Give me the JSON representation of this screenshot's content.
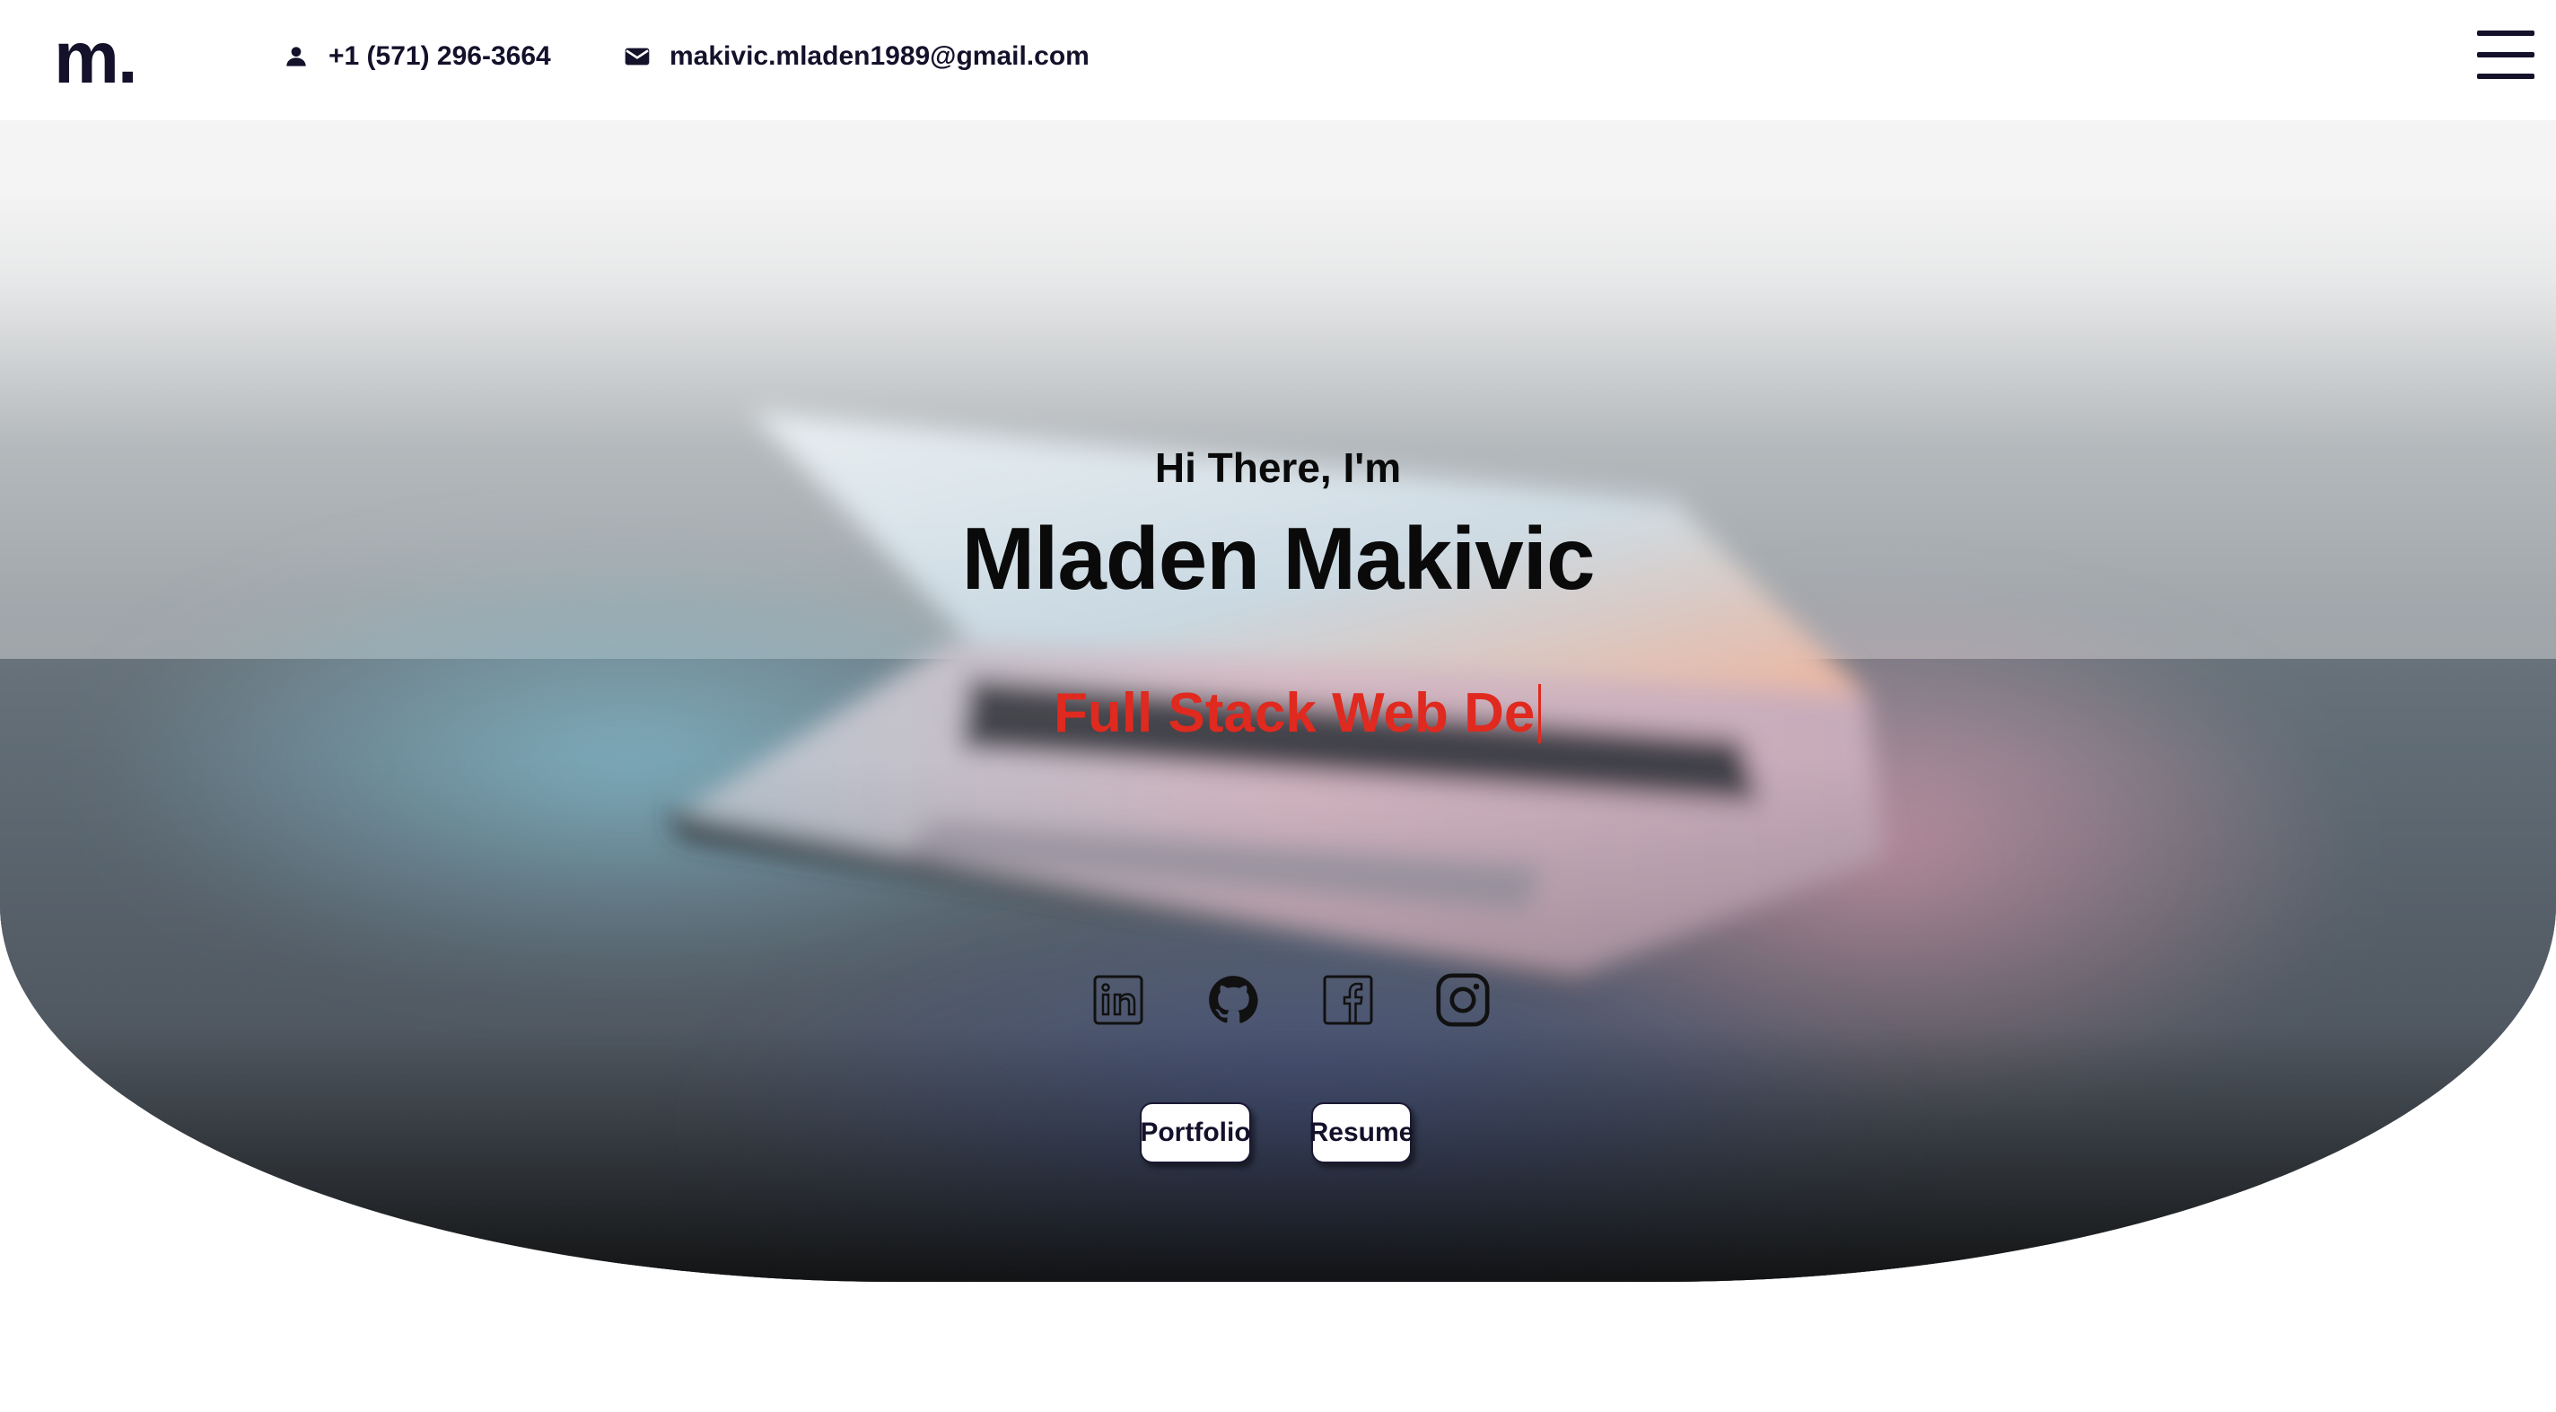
{
  "header": {
    "logo": "m.",
    "phone": "+1 (571) 296-3664",
    "email": "makivic.mladen1989@gmail.com",
    "phone_icon": "person-icon",
    "email_icon": "mail-icon",
    "menu_icon": "hamburger-menu-icon"
  },
  "hero": {
    "greeting": "Hi There, I'm",
    "name": "Mladen Makivic",
    "typed_role": "Full Stack Web De",
    "socials": [
      {
        "name": "linkedin-icon"
      },
      {
        "name": "github-icon"
      },
      {
        "name": "facebook-icon"
      },
      {
        "name": "instagram-icon"
      }
    ],
    "buttons": {
      "portfolio": "Portfolio",
      "resume": "Resume"
    }
  },
  "colors": {
    "brand_dark": "#14112b",
    "accent_red": "#e0291f",
    "background": "#ffffff"
  }
}
